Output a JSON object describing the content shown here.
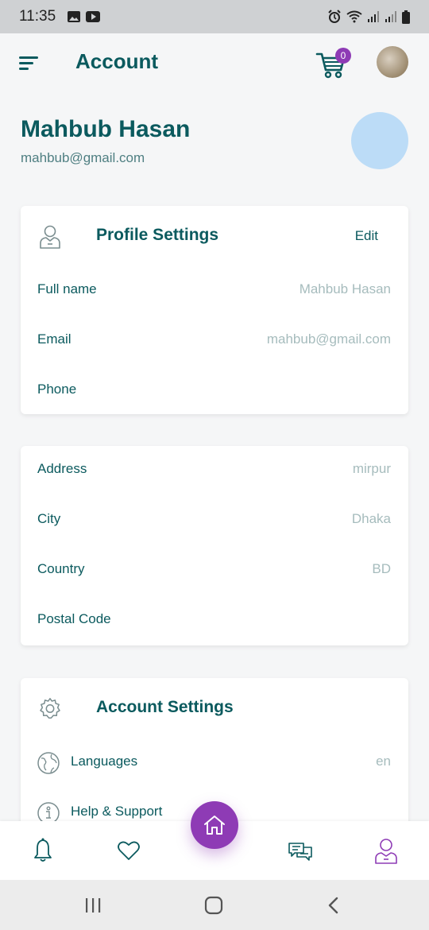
{
  "status_bar": {
    "time": "11:35"
  },
  "app_bar": {
    "title": "Account",
    "cart_count": "0"
  },
  "user": {
    "name": "Mahbub Hasan",
    "email": "mahbub@gmail.com"
  },
  "profile_card": {
    "title": "Profile Settings",
    "edit_label": "Edit",
    "rows": [
      {
        "label": "Full name",
        "value": "Mahbub Hasan"
      },
      {
        "label": "Email",
        "value": "mahbub@gmail.com"
      },
      {
        "label": "Phone",
        "value": ""
      }
    ]
  },
  "address_card": {
    "rows": [
      {
        "label": "Address",
        "value": "mirpur"
      },
      {
        "label": "City",
        "value": "Dhaka"
      },
      {
        "label": "Country",
        "value": "BD"
      },
      {
        "label": "Postal Code",
        "value": ""
      }
    ]
  },
  "account_card": {
    "title": "Account Settings",
    "rows": [
      {
        "label": "Languages",
        "value": "en",
        "icon": "globe-icon"
      },
      {
        "label": "Help & Support",
        "value": "",
        "icon": "info-icon"
      }
    ]
  },
  "bottom_nav": {
    "items": [
      "bell-icon",
      "heart-icon",
      "home-icon",
      "chat-icon",
      "user-icon"
    ],
    "active": "home"
  },
  "colors": {
    "primary": "#0b5a5e",
    "accent": "#8e3bb5",
    "muted": "#a6bcbd",
    "avatar_placeholder": "#bcdcf7"
  }
}
